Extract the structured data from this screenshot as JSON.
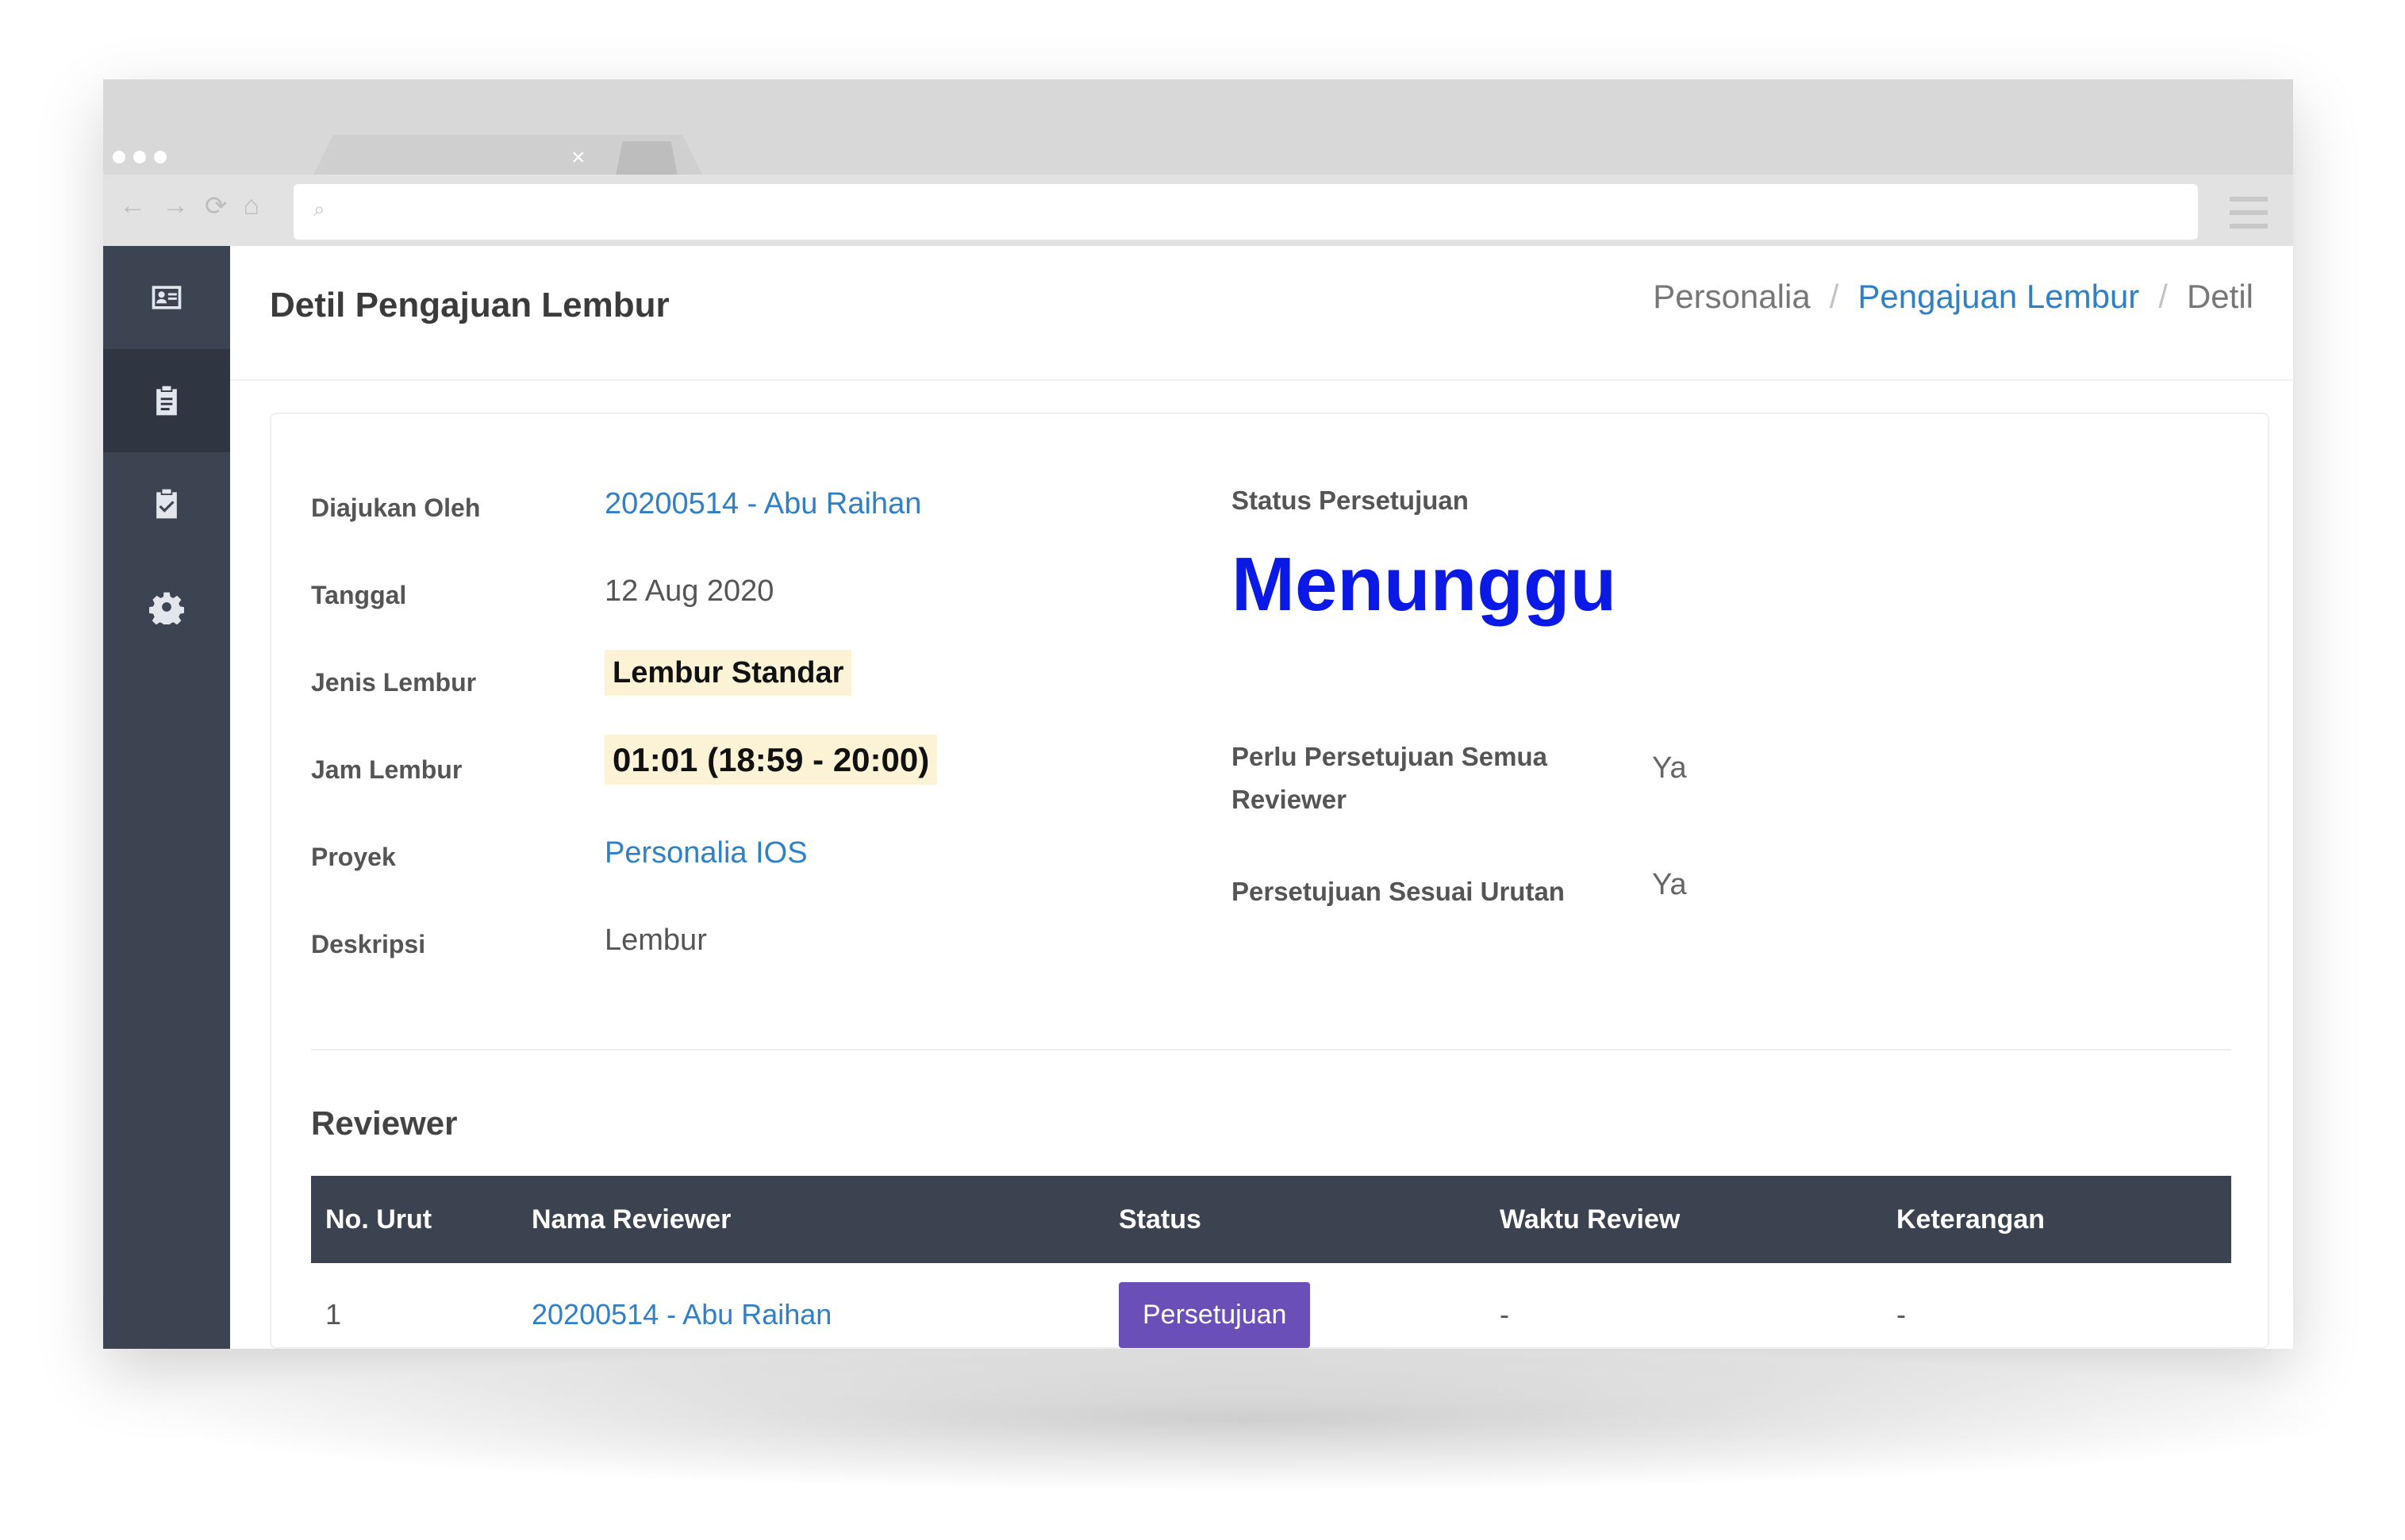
{
  "browser": {
    "close_glyph": "×",
    "nav_icons": [
      "←",
      "→",
      "⟳",
      "⌂"
    ],
    "search_glyph": "⌕"
  },
  "sidebar": {
    "items": [
      {
        "icon": "id-card-icon",
        "active": false
      },
      {
        "icon": "clipboard-icon",
        "active": true
      },
      {
        "icon": "clipboard-check-icon",
        "active": false
      },
      {
        "icon": "gear-icon",
        "active": false
      }
    ]
  },
  "header": {
    "title": "Detil Pengajuan Lembur",
    "breadcrumb": [
      "Personalia",
      "Pengajuan Lembur",
      "Detil"
    ],
    "separator": "/"
  },
  "details": {
    "diajukan_oleh": {
      "label": "Diajukan Oleh",
      "value": "20200514 - Abu Raihan"
    },
    "tanggal": {
      "label": "Tanggal",
      "value": "12 Aug 2020"
    },
    "jenis_lembur": {
      "label": "Jenis Lembur",
      "value": "Lembur Standar"
    },
    "jam_lembur": {
      "label": "Jam Lembur",
      "value": "01:01 (18:59 - 20:00)"
    },
    "proyek": {
      "label": "Proyek",
      "value": "Personalia IOS"
    },
    "deskripsi": {
      "label": "Deskripsi",
      "value": "Lembur"
    }
  },
  "approval": {
    "status_label": "Status Persetujuan",
    "status_value": "Menunggu",
    "status_color": "#0a19e6",
    "all_reviewers_label": "Perlu Persetujuan Semua Reviewer",
    "all_reviewers_value": "Ya",
    "ordered_label": "Persetujuan Sesuai Urutan",
    "ordered_value": "Ya"
  },
  "reviewer": {
    "heading": "Reviewer",
    "columns": [
      "No. Urut",
      "Nama Reviewer",
      "Status",
      "Waktu Review",
      "Keterangan"
    ],
    "rows": [
      {
        "no": "1",
        "name": "20200514 - Abu Raihan",
        "status": "Persetujuan",
        "waktu": "-",
        "keterangan": "-"
      }
    ]
  },
  "colors": {
    "sidebar": "#3c4452",
    "table_header": "#3b4350",
    "link": "#2f80c6",
    "badge_bg": "#fcf3d6",
    "button": "#6a4fb8",
    "chat": "#2f6b7f"
  }
}
